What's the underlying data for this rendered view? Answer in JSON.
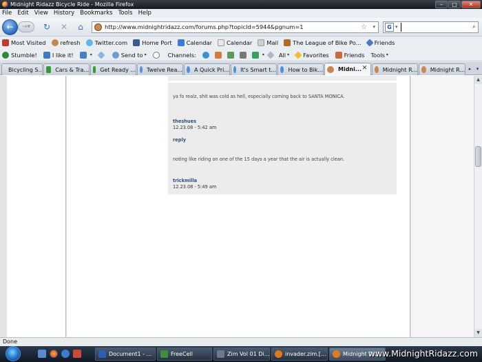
{
  "window": {
    "title": "Midnight Ridazz Bicycle Ride - Mozilla Firefox",
    "controls": {
      "minimize": "–",
      "maximize": "□",
      "close": "✕"
    }
  },
  "menu": [
    "File",
    "Edit",
    "View",
    "History",
    "Bookmarks",
    "Tools",
    "Help"
  ],
  "navigation": {
    "url": "http://www.midnightridazz.com/forums.php?topicId=5944&pgnum=1",
    "search_value": ""
  },
  "bookmarks": [
    {
      "label": "Most Visited",
      "color": "#c23a2b"
    },
    {
      "label": "refresh",
      "color": "#c9884f"
    },
    {
      "label": "Twitter.com",
      "color": "#5fb6e8"
    },
    {
      "label": "Home Port",
      "color": "#3b5998"
    },
    {
      "label": "Calendar",
      "color": "#3a7bd5"
    },
    {
      "label": "Calendar",
      "color": "#e8e8e8"
    },
    {
      "label": "Mail",
      "color": "#cfcfcf"
    },
    {
      "label": "The League of Bike Po...",
      "color": "#b06a2a"
    },
    {
      "label": "Friends",
      "color": "#4a78c2"
    }
  ],
  "stumble_toolbar": {
    "stumble": "Stumble!",
    "like": "I like it!",
    "send_to": "Send to",
    "channels": "Channels:",
    "all": "All",
    "favorites": "Favorites",
    "friends": "Friends",
    "tools": "Tools"
  },
  "tabs": [
    {
      "label": "Bicycling S...",
      "active": false
    },
    {
      "label": "Cars & Tra...",
      "active": false
    },
    {
      "label": "Get Ready ...",
      "active": false
    },
    {
      "label": "Twelve Rea...",
      "active": false
    },
    {
      "label": "A Quick Pri...",
      "active": false
    },
    {
      "label": "It's Smart t...",
      "active": false
    },
    {
      "label": "How to Bik...",
      "active": false
    },
    {
      "label": "Midni...",
      "active": true
    },
    {
      "label": "Midnight R...",
      "active": false
    },
    {
      "label": "Midnight R...",
      "active": false
    }
  ],
  "posts": [
    {
      "message": "ya fo realz, shit was cold as hell, especially coming back to SANTA MONICA.",
      "username": "theshues",
      "timestamp": "12.23.08 - 5:42 am",
      "reply": "reply"
    },
    {
      "message": "noting like riding on one of the 15 days a year that the air is actually clean.",
      "username": "trickmilla",
      "timestamp": "12.23.08 - 5:49 am"
    }
  ],
  "status": "Done",
  "taskbar": [
    {
      "label": "Document1 - ...",
      "color": "#2b5fb4"
    },
    {
      "label": "FreeCell",
      "color": "#3d8f3d"
    },
    {
      "label": "Zim Vol 01 Di...",
      "color": "#6b7b8c"
    },
    {
      "label": "invader.zim.[...",
      "color": "#e07a1f"
    },
    {
      "label": "Midnight Rid...",
      "color": "#e07a1f"
    }
  ],
  "watermark": "www.MidnightRidazz.com"
}
